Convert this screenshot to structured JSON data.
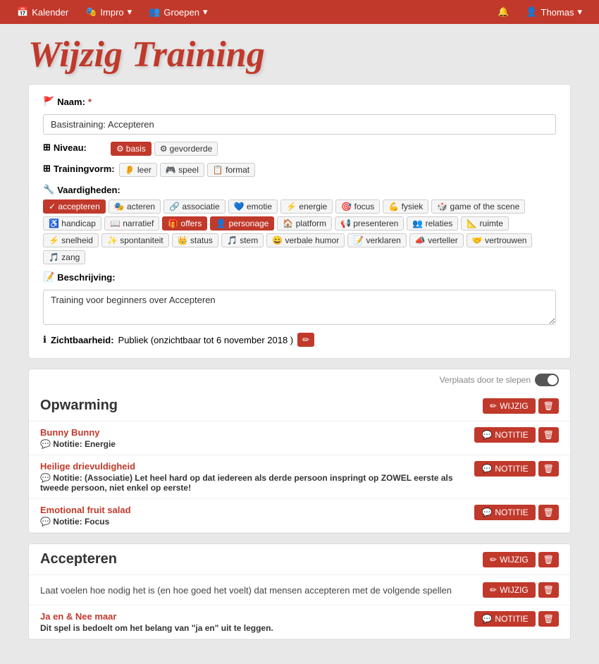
{
  "navbar": {
    "items": [
      {
        "id": "kalender",
        "label": "Kalender",
        "icon": "📅",
        "dropdown": false
      },
      {
        "id": "impro",
        "label": "Impro",
        "icon": "🎭",
        "dropdown": true
      },
      {
        "id": "groepen",
        "label": "Groepen",
        "icon": "👥",
        "dropdown": true
      }
    ],
    "right": {
      "notification_icon": "🔔",
      "user_icon": "👤",
      "user_name": "Thomas",
      "dropdown": true
    }
  },
  "page": {
    "title": "Wijzig Training",
    "form": {
      "naam_label": "Naam:",
      "naam_required": "*",
      "naam_value": "Basistraining: Accepteren",
      "niveau_label": "Niveau:",
      "niveau_tags": [
        {
          "label": "basis",
          "active": true,
          "icon": "⚙"
        },
        {
          "label": "gevorderde",
          "active": false,
          "icon": "⚙"
        }
      ],
      "trainingvorm_label": "Trainingvorm:",
      "trainingvorm_tags": [
        {
          "label": "leer",
          "icon": "👂"
        },
        {
          "label": "speel",
          "icon": "🎮"
        },
        {
          "label": "format",
          "icon": "📋"
        }
      ],
      "vaardigheden_label": "Vaardigheden:",
      "vaardigheden_tags": [
        {
          "label": "accepteren",
          "active": true,
          "icon": "✓"
        },
        {
          "label": "acteren",
          "active": false,
          "icon": "🎭"
        },
        {
          "label": "associatie",
          "active": false,
          "icon": "🔗"
        },
        {
          "label": "emotie",
          "active": false,
          "icon": "💙"
        },
        {
          "label": "energie",
          "active": false,
          "icon": "⚡"
        },
        {
          "label": "focus",
          "active": false,
          "icon": "🎯"
        },
        {
          "label": "fysiek",
          "active": false,
          "icon": "💪"
        },
        {
          "label": "game of the scene",
          "active": false,
          "icon": "🎲"
        },
        {
          "label": "handicap",
          "active": false,
          "icon": "♿"
        },
        {
          "label": "narratief",
          "active": false,
          "icon": "📖"
        },
        {
          "label": "offers",
          "active": true,
          "icon": "🎁"
        },
        {
          "label": "personage",
          "active": true,
          "icon": "👤"
        },
        {
          "label": "platform",
          "active": false,
          "icon": "🏠"
        },
        {
          "label": "presenteren",
          "active": false,
          "icon": "📢"
        },
        {
          "label": "relaties",
          "active": false,
          "icon": "👥"
        },
        {
          "label": "ruimte",
          "active": false,
          "icon": "📐"
        },
        {
          "label": "snelheid",
          "active": false,
          "icon": "⚡"
        },
        {
          "label": "spontaniteit",
          "active": false,
          "icon": "✨"
        },
        {
          "label": "status",
          "active": false,
          "icon": "👑"
        },
        {
          "label": "stem",
          "active": false,
          "icon": "🎵"
        },
        {
          "label": "verbale humor",
          "active": false,
          "icon": "😄"
        },
        {
          "label": "verklaren",
          "active": false,
          "icon": "📝"
        },
        {
          "label": "verteller",
          "active": false,
          "icon": "📣"
        },
        {
          "label": "vertrouwen",
          "active": false,
          "icon": "🤝"
        },
        {
          "label": "zang",
          "active": false,
          "icon": "🎵"
        }
      ],
      "beschrijving_label": "Beschrijving:",
      "beschrijving_value": "Training voor beginners over Accepteren",
      "zichtbaarheid_label": "Zichtbaarheid:",
      "zichtbaarheid_value": "Publiek (onzichtbaar tot 6 november 2018 )"
    }
  },
  "sections": [
    {
      "id": "opwarming",
      "title": "Opwarming",
      "drag_hint": "Verplaats door te slepen",
      "btn_wijzig": "WIJZIG",
      "btn_notitie": "NOTITIE",
      "exercises": [
        {
          "title": "Bunny Bunny",
          "notitie_label": "Notitie:",
          "notitie_value": "Energie",
          "has_notitie_btn": true
        },
        {
          "title": "Heilige drievuldigheid",
          "notitie_label": "Notitie:",
          "notitie_value": "(Associatie) Let heel hard op dat iedereen als derde persoon inspringt op ZOWEL eerste als tweede persoon, niet enkel op eerste!",
          "has_notitie_btn": true
        },
        {
          "title": "Emotional fruit salad",
          "notitie_label": "Notitie:",
          "notitie_value": "Focus",
          "has_notitie_btn": true
        }
      ]
    },
    {
      "id": "accepteren",
      "title": "Accepteren",
      "description": "Laat voelen hoe nodig het is (en hoe goed het voelt) dat mensen accepteren met de volgende spellen",
      "btn_wijzig": "WIJZIG",
      "btn_notitie": "NOTITIE",
      "exercises": [
        {
          "title": "Ja en & Nee maar",
          "notitie_label": "",
          "notitie_value": "Dit spel is bedoelt om het belang van \"ja en\" uit te leggen.",
          "has_notitie_btn": true
        }
      ]
    }
  ]
}
